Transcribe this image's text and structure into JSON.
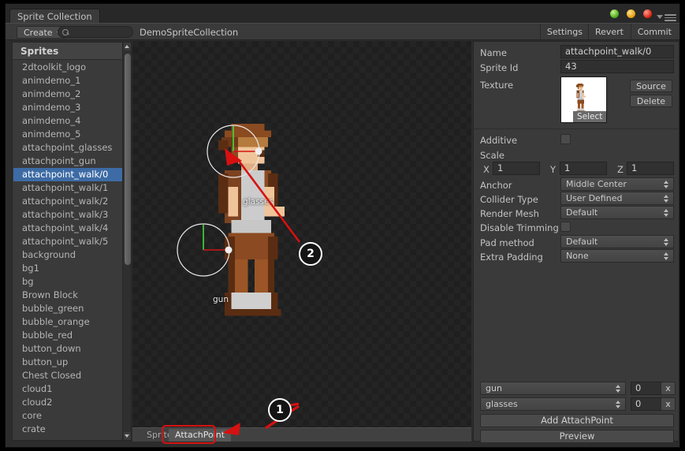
{
  "window": {
    "tab_title": "Sprite Collection",
    "lights": [
      "green",
      "yellow",
      "red"
    ]
  },
  "toolbar": {
    "create_label": "Create",
    "search_placeholder": "",
    "collection_name": "DemoSpriteCollection",
    "settings_label": "Settings",
    "revert_label": "Revert",
    "commit_label": "Commit"
  },
  "sprites_panel": {
    "header": "Sprites",
    "selected": "attachpoint_walk/0",
    "items": [
      "2dtoolkit_logo",
      "animdemo_1",
      "animdemo_2",
      "animdemo_3",
      "animdemo_4",
      "animdemo_5",
      "attachpoint_glasses",
      "attachpoint_gun",
      "attachpoint_walk/0",
      "attachpoint_walk/1",
      "attachpoint_walk/2",
      "attachpoint_walk/3",
      "attachpoint_walk/4",
      "attachpoint_walk/5",
      "background",
      "bg1",
      "bg",
      "Brown Block",
      "bubble_green",
      "bubble_orange",
      "bubble_red",
      "button_down",
      "button_up",
      "Chest Closed",
      "cloud1",
      "cloud2",
      "core",
      "crate"
    ]
  },
  "canvas": {
    "gizmos": [
      {
        "label": "glasses"
      },
      {
        "label": "gun"
      }
    ],
    "tabs": [
      {
        "label": "Sprite",
        "active": false
      },
      {
        "label": "AttachPoint",
        "active": true
      }
    ]
  },
  "inspector": {
    "name_label": "Name",
    "name_value": "attachpoint_walk/0",
    "sprite_id_label": "Sprite Id",
    "sprite_id_value": "43",
    "texture_label": "Texture",
    "select_badge": "Select",
    "source_button": "Source",
    "delete_button": "Delete",
    "additive_label": "Additive",
    "scale_label": "Scale",
    "scale_x_label": "X",
    "scale_x_value": "1",
    "scale_y_label": "Y",
    "scale_y_value": "1",
    "scale_z_label": "Z",
    "scale_z_value": "1",
    "anchor_label": "Anchor",
    "anchor_value": "Middle Center",
    "collider_label": "Collider Type",
    "collider_value": "User Defined",
    "render_mesh_label": "Render Mesh",
    "render_mesh_value": "Default",
    "disable_trim_label": "Disable Trimming",
    "pad_method_label": "Pad method",
    "pad_method_value": "Default",
    "extra_padding_label": "Extra Padding",
    "extra_padding_value": "None",
    "attachpoints": [
      {
        "name": "gun",
        "value": "0",
        "remove": "x"
      },
      {
        "name": "glasses",
        "value": "0",
        "remove": "x"
      }
    ],
    "add_attachpoint_button": "Add AttachPoint",
    "preview_button": "Preview"
  },
  "annotations": {
    "callouts": [
      {
        "number": "1"
      },
      {
        "number": "2"
      }
    ],
    "highlight_color": "#d51111"
  }
}
